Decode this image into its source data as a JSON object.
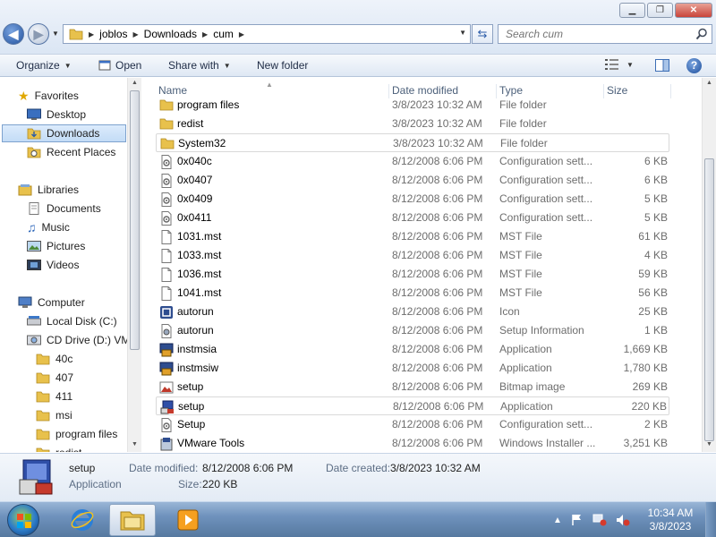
{
  "window": {
    "minimize_label": "▁",
    "maximize_label": "❐",
    "close_label": "✕"
  },
  "address": {
    "crumbs": [
      "joblos",
      "Downloads",
      "cum"
    ],
    "search_placeholder": "Search cum"
  },
  "toolbar": {
    "organize": "Organize",
    "open": "Open",
    "share_with": "Share with",
    "new_folder": "New folder"
  },
  "nav": {
    "favorites": "Favorites",
    "desktop": "Desktop",
    "downloads": "Downloads",
    "recent_places": "Recent Places",
    "libraries": "Libraries",
    "documents": "Documents",
    "music": "Music",
    "pictures": "Pictures",
    "videos": "Videos",
    "computer": "Computer",
    "local_disk": "Local Disk (C:)",
    "cd_drive": "CD Drive (D:) VM",
    "subfolders": [
      "40c",
      "407",
      "411",
      "msi",
      "program files",
      "redist"
    ]
  },
  "columns": {
    "name": "Name",
    "date_modified": "Date modified",
    "type": "Type",
    "size": "Size"
  },
  "files": [
    {
      "name": "program files",
      "date": "3/8/2023 10:32 AM",
      "type": "File folder",
      "size": "",
      "icon": "folder-icon"
    },
    {
      "name": "redist",
      "date": "3/8/2023 10:32 AM",
      "type": "File folder",
      "size": "",
      "icon": "folder-icon"
    },
    {
      "name": "System32",
      "date": "3/8/2023 10:32 AM",
      "type": "File folder",
      "size": "",
      "icon": "folder-icon"
    },
    {
      "name": "0x040c",
      "date": "8/12/2008 6:06 PM",
      "type": "Configuration sett...",
      "size": "6 KB",
      "icon": "config-file-icon"
    },
    {
      "name": "0x0407",
      "date": "8/12/2008 6:06 PM",
      "type": "Configuration sett...",
      "size": "6 KB",
      "icon": "config-file-icon"
    },
    {
      "name": "0x0409",
      "date": "8/12/2008 6:06 PM",
      "type": "Configuration sett...",
      "size": "5 KB",
      "icon": "config-file-icon"
    },
    {
      "name": "0x0411",
      "date": "8/12/2008 6:06 PM",
      "type": "Configuration sett...",
      "size": "5 KB",
      "icon": "config-file-icon"
    },
    {
      "name": "1031.mst",
      "date": "8/12/2008 6:06 PM",
      "type": "MST File",
      "size": "61 KB",
      "icon": "blank-file-icon"
    },
    {
      "name": "1033.mst",
      "date": "8/12/2008 6:06 PM",
      "type": "MST File",
      "size": "4 KB",
      "icon": "blank-file-icon"
    },
    {
      "name": "1036.mst",
      "date": "8/12/2008 6:06 PM",
      "type": "MST File",
      "size": "59 KB",
      "icon": "blank-file-icon"
    },
    {
      "name": "1041.mst",
      "date": "8/12/2008 6:06 PM",
      "type": "MST File",
      "size": "56 KB",
      "icon": "blank-file-icon"
    },
    {
      "name": "autorun",
      "date": "8/12/2008 6:06 PM",
      "type": "Icon",
      "size": "25 KB",
      "icon": "vmware-icon"
    },
    {
      "name": "autorun",
      "date": "8/12/2008 6:06 PM",
      "type": "Setup Information",
      "size": "1 KB",
      "icon": "setup-info-icon"
    },
    {
      "name": "instmsia",
      "date": "8/12/2008 6:06 PM",
      "type": "Application",
      "size": "1,669 KB",
      "icon": "installer-app-icon"
    },
    {
      "name": "instmsiw",
      "date": "8/12/2008 6:06 PM",
      "type": "Application",
      "size": "1,780 KB",
      "icon": "installer-app-icon"
    },
    {
      "name": "setup",
      "date": "8/12/2008 6:06 PM",
      "type": "Bitmap image",
      "size": "269 KB",
      "icon": "bitmap-icon"
    },
    {
      "name": "setup",
      "date": "8/12/2008 6:06 PM",
      "type": "Application",
      "size": "220 KB",
      "icon": "setup-app-icon"
    },
    {
      "name": "Setup",
      "date": "8/12/2008 6:06 PM",
      "type": "Configuration sett...",
      "size": "2 KB",
      "icon": "config-file-icon"
    },
    {
      "name": "VMware Tools",
      "date": "8/12/2008 6:06 PM",
      "type": "Windows Installer ...",
      "size": "3,251 KB",
      "icon": "msi-package-icon"
    }
  ],
  "details": {
    "name": "setup",
    "type": "Application",
    "date_modified_label": "Date modified:",
    "date_modified": "8/12/2008 6:06 PM",
    "date_created_label": "Date created:",
    "date_created": "3/8/2023 10:32 AM",
    "size_label": "Size:",
    "size": "220 KB"
  },
  "taskbar": {
    "time": "10:34 AM",
    "date": "3/8/2023"
  }
}
